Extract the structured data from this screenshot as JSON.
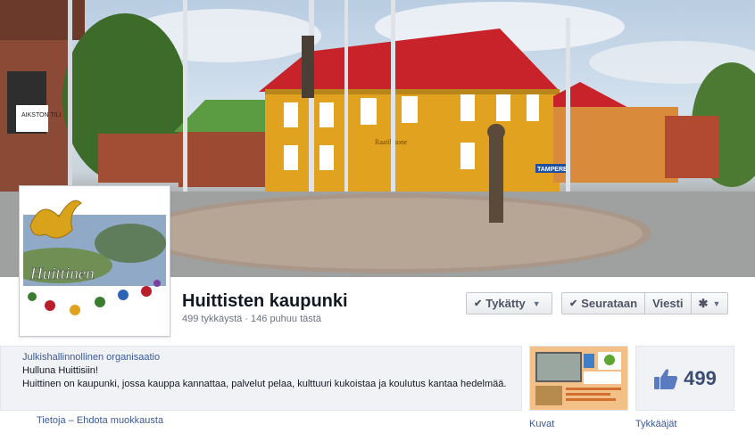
{
  "page": {
    "name": "Huittisten kaupunki",
    "stats": "499 tykkäystä · 146 puhuu tästä"
  },
  "profile": {
    "logo_text": "Huittinen"
  },
  "cover": {
    "shop_sign": "AIKSTON TILI",
    "building_sign": "Raatihuone",
    "road_sign": "TAMPERE"
  },
  "actions": {
    "liked": "Tykätty",
    "following": "Seurataan",
    "message": "Viesti"
  },
  "about": {
    "category": "Julkishallinnollinen organisaatio",
    "slogan": "Hulluna Huittisiin!",
    "description": "Huittinen on kaupunki, jossa kauppa kannattaa, palvelut pelaa, kulttuuri kukoistaa ja koulutus kantaa hedelmää.",
    "info_link": "Tietoja",
    "suggest_link": "Ehdota muokkausta"
  },
  "apps": {
    "photos_label": "Kuvat",
    "likes_label": "Tykkääjät",
    "likes_count": "499"
  },
  "colors": {
    "link": "#3b5998",
    "building_yellow": "#e0a21f",
    "roof_red": "#c8232a"
  },
  "icons": [
    "check-icon",
    "caret-down-icon",
    "gear-icon",
    "thumbs-up-icon"
  ]
}
